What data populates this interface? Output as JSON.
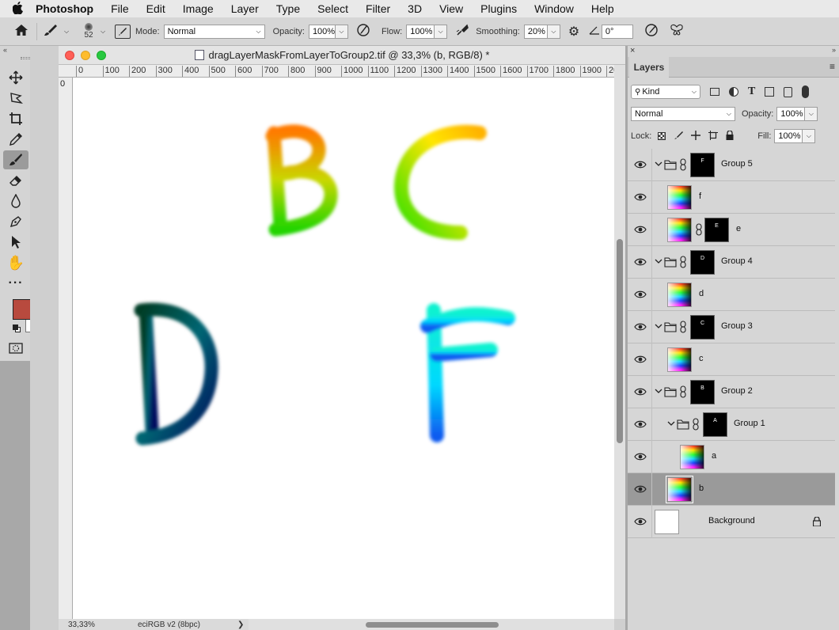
{
  "menubar": {
    "app_name": "Photoshop",
    "items": [
      "File",
      "Edit",
      "Image",
      "Layer",
      "Type",
      "Select",
      "Filter",
      "3D",
      "View",
      "Plugins",
      "Window",
      "Help"
    ]
  },
  "options": {
    "brush_size": "52",
    "mode_label": "Mode:",
    "mode_value": "Normal",
    "opacity_label": "Opacity:",
    "opacity_value": "100%",
    "flow_label": "Flow:",
    "flow_value": "100%",
    "smoothing_label": "Smoothing:",
    "smoothing_value": "20%",
    "angle_value": "0°"
  },
  "document": {
    "title": "dragLayerMaskFromLayerToGroup2.tif @ 33,3% (b, RGB/8) *",
    "zoom": "33,33%",
    "profile": "eciRGB v2 (8bpc)",
    "ruler_top": [
      "0",
      "100",
      "200",
      "300",
      "400",
      "500",
      "600",
      "700",
      "800",
      "900",
      "1000",
      "1100",
      "1200",
      "1300",
      "1400",
      "1500",
      "1600",
      "1700",
      "1800",
      "1900",
      "20"
    ],
    "canvas_letters": [
      "B",
      "C",
      "D",
      "F"
    ]
  },
  "colors": {
    "foreground": "#b84a3e",
    "background": "#ffffff"
  },
  "layers_panel": {
    "tab": "Layers",
    "filter_kind": "Kind",
    "blend_mode": "Normal",
    "opacity_label": "Opacity:",
    "opacity_value": "100%",
    "lock_label": "Lock:",
    "fill_label": "Fill:",
    "fill_value": "100%",
    "layers": [
      {
        "name": "Group 5",
        "mask_letter": "F"
      },
      {
        "name": "f"
      },
      {
        "name": "e",
        "mask_letter": "E"
      },
      {
        "name": "Group 4",
        "mask_letter": "D"
      },
      {
        "name": "d"
      },
      {
        "name": "Group 3",
        "mask_letter": "C"
      },
      {
        "name": "c"
      },
      {
        "name": "Group 2",
        "mask_letter": "B"
      },
      {
        "name": "Group 1",
        "mask_letter": "A"
      },
      {
        "name": "a"
      },
      {
        "name": "b"
      },
      {
        "name": "Background"
      }
    ]
  }
}
